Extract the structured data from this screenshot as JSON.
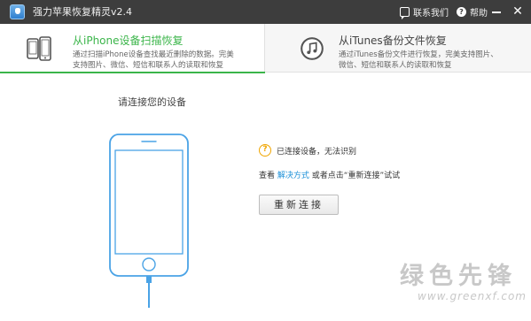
{
  "titlebar": {
    "title": "强力苹果恢复精灵v2.4",
    "contact_label": "联系我们",
    "help_label": "帮助",
    "help_icon_glyph": "?",
    "close_glyph": "✕"
  },
  "tabs": [
    {
      "title": "从iPhone设备扫描恢复",
      "desc": "通过扫描iPhone设备查找最近删除的数据。完美支持图片、微信、短信和联系人的读取和恢复",
      "icon": "phones-icon",
      "active": true
    },
    {
      "title": "从iTunes备份文件恢复",
      "desc": "通过iTunes备份文件进行恢复，完美支持图片、微信、短信和联系人的读取和恢复",
      "icon": "itunes-icon",
      "active": false
    }
  ],
  "main": {
    "connect_title": "请连接您的设备",
    "status_icon_glyph": "?",
    "status_text": "已连接设备，无法识别",
    "hint_prefix": "查看",
    "hint_link": "解决方式",
    "hint_suffix": "或者点击“重新连接”试试",
    "reconnect_label": "重新连接"
  },
  "watermark": {
    "main": "绿色先锋",
    "sub": "www.greenxf.com"
  },
  "colors": {
    "accent_green": "#3bb54a",
    "link_blue": "#1a8fd8",
    "warning_orange": "#f0a500",
    "titlebar_bg": "#3d3d3d",
    "phone_outline": "#4aa3e6"
  }
}
